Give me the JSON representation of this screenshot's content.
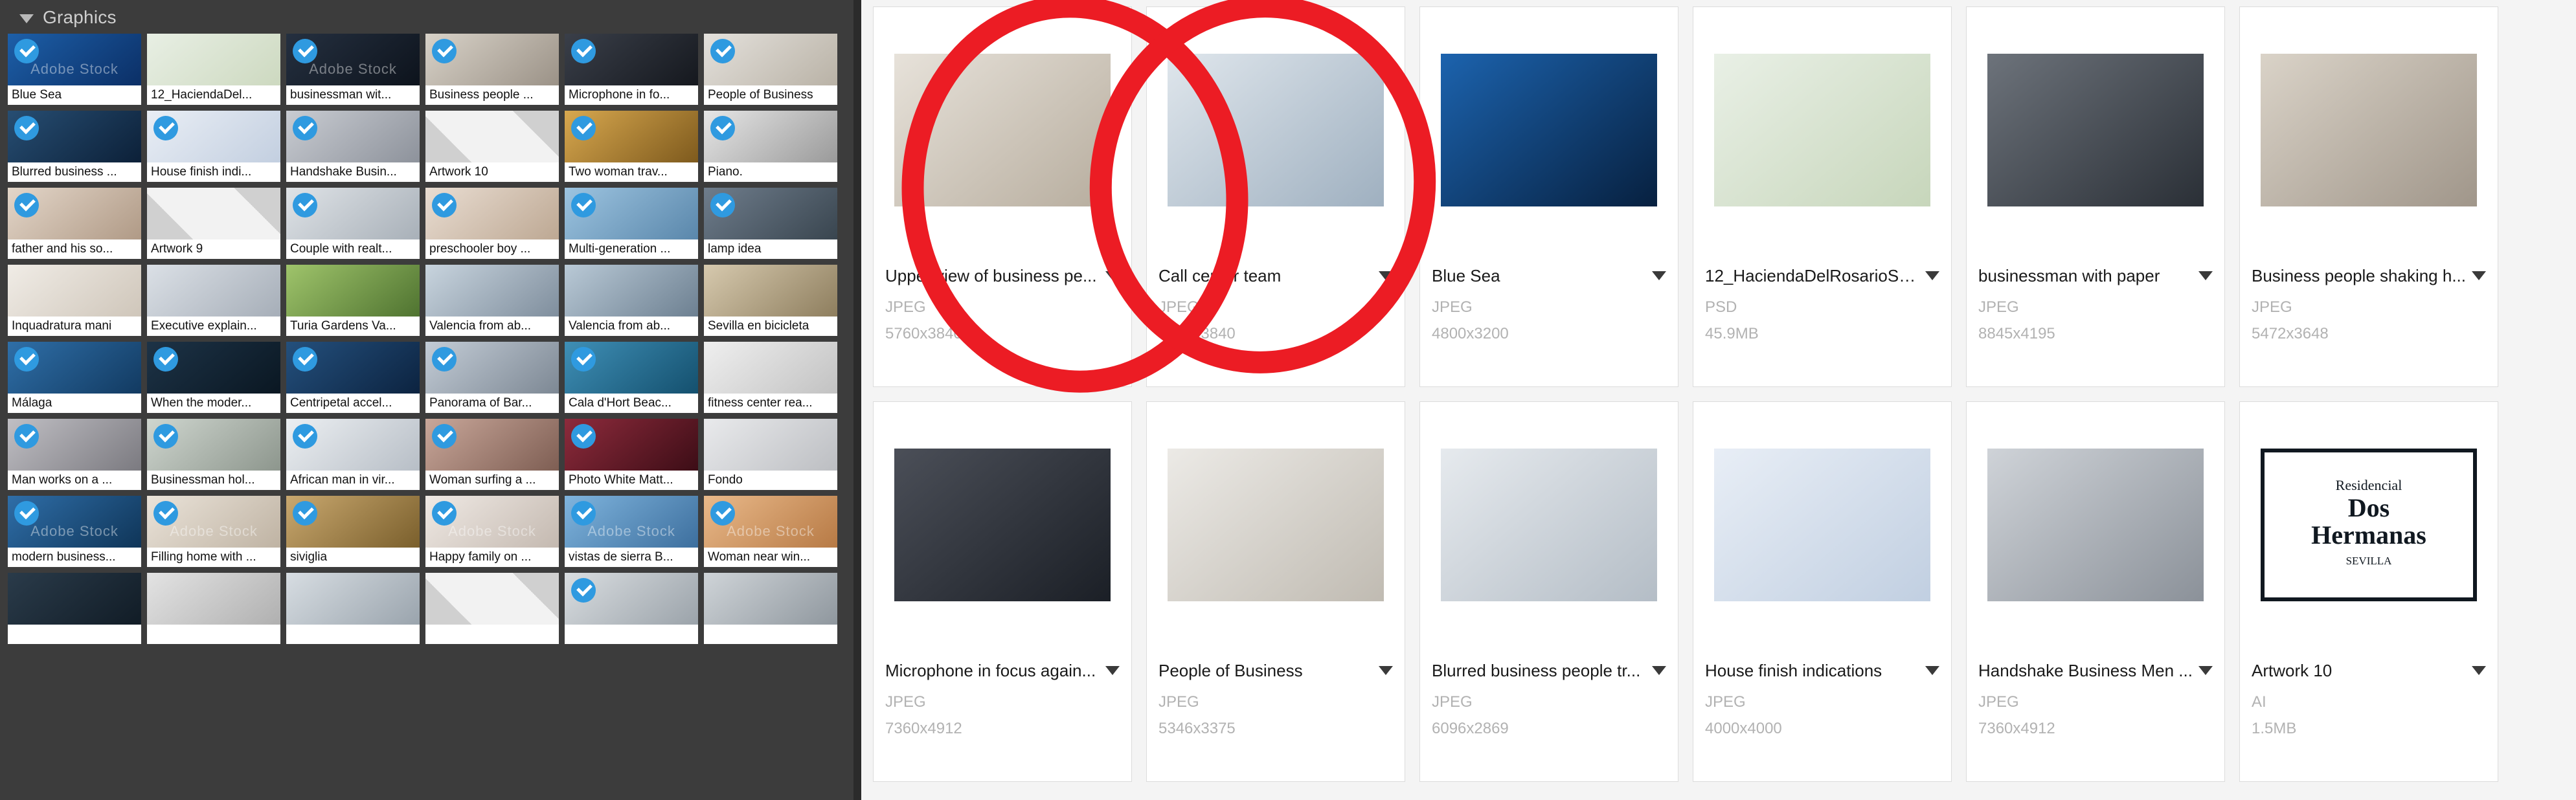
{
  "sidebar": {
    "header": {
      "title": "Graphics",
      "collapse_icon": "triangle-down-icon"
    },
    "watermark_text": "Adobe Stock",
    "items": [
      {
        "label": "Blue Sea",
        "selected": true,
        "c1": "#1d5fa8",
        "c2": "#0b2f66",
        "wm": true
      },
      {
        "label": "12_HaciendaDel...",
        "selected": false,
        "c1": "#e8efe4",
        "c2": "#cdd9c0",
        "wm": false
      },
      {
        "label": "businessman wit...",
        "selected": true,
        "c1": "#253040",
        "c2": "#0d131c",
        "wm": true
      },
      {
        "label": "Business people ...",
        "selected": true,
        "c1": "#d8d2c8",
        "c2": "#9b9287",
        "wm": false
      },
      {
        "label": "Microphone in fo...",
        "selected": true,
        "c1": "#3a3f49",
        "c2": "#15181e",
        "wm": false
      },
      {
        "label": "People of Business",
        "selected": true,
        "c1": "#e4e1dc",
        "c2": "#b9b2a6",
        "wm": false
      },
      {
        "label": "Blurred business ...",
        "selected": true,
        "c1": "#274e73",
        "c2": "#0c2038",
        "wm": false
      },
      {
        "label": "House finish indi...",
        "selected": true,
        "c1": "#e9eef5",
        "c2": "#c3cfe0",
        "wm": false
      },
      {
        "label": "Handshake Busin...",
        "selected": true,
        "c1": "#c9ccd2",
        "c2": "#8d929b",
        "wm": false
      },
      {
        "label": "Artwork 10",
        "selected": false,
        "c1": "#2b2b2b",
        "c2": "#1a1a1a",
        "wm": false,
        "checker": true
      },
      {
        "label": "Two woman trav...",
        "selected": true,
        "c1": "#d8a84f",
        "c2": "#7e5a1d",
        "wm": false
      },
      {
        "label": "Piano.",
        "selected": true,
        "c1": "#e6e6e6",
        "c2": "#9a9a9a",
        "wm": false
      },
      {
        "label": "father and his so...",
        "selected": true,
        "c1": "#e3d6c9",
        "c2": "#b09a86",
        "wm": false
      },
      {
        "label": "Artwork 9",
        "selected": false,
        "c1": "#2f3a46",
        "c2": "#16202b",
        "wm": false,
        "checker": true
      },
      {
        "label": "Couple with realt...",
        "selected": true,
        "c1": "#dfe3e7",
        "c2": "#a8b0b8",
        "wm": false
      },
      {
        "label": "preschooler boy ...",
        "selected": true,
        "c1": "#e9ddd2",
        "c2": "#bda893",
        "wm": false
      },
      {
        "label": "Multi-generation ...",
        "selected": true,
        "c1": "#9dc4e0",
        "c2": "#5a87ab",
        "wm": false
      },
      {
        "label": "lamp idea",
        "selected": true,
        "c1": "#6f7d8c",
        "c2": "#39454f",
        "wm": false
      },
      {
        "label": "Inquadratura mani",
        "selected": false,
        "c1": "#f0ece6",
        "c2": "#cfc6ba",
        "wm": false
      },
      {
        "label": "Executive explain...",
        "selected": false,
        "c1": "#dbe0e6",
        "c2": "#a6aeb8",
        "wm": false
      },
      {
        "label": "Turia Gardens Va...",
        "selected": false,
        "c1": "#9fc46b",
        "c2": "#4f7330",
        "wm": false
      },
      {
        "label": "Valencia from ab...",
        "selected": false,
        "c1": "#c8d4de",
        "c2": "#7f8e9d",
        "wm": false
      },
      {
        "label": "Valencia from ab...",
        "selected": false,
        "c1": "#b9c9d6",
        "c2": "#6d8091",
        "wm": false
      },
      {
        "label": "Sevilla en bicicleta",
        "selected": false,
        "c1": "#d6c9ae",
        "c2": "#8e7e5e",
        "wm": false
      },
      {
        "label": "Málaga",
        "selected": true,
        "c1": "#2f6fa8",
        "c2": "#123a61",
        "wm": false
      },
      {
        "label": "When the moder...",
        "selected": true,
        "c1": "#1d3347",
        "c2": "#0a1722",
        "wm": false
      },
      {
        "label": "Centripetal accel...",
        "selected": true,
        "c1": "#24507d",
        "c2": "#0c2340",
        "wm": false
      },
      {
        "label": "Panorama of Bar...",
        "selected": true,
        "c1": "#c3ccd6",
        "c2": "#7d8894",
        "wm": false
      },
      {
        "label": "Cala d'Hort Beac...",
        "selected": true,
        "c1": "#3f8fb6",
        "c2": "#14506e",
        "wm": false
      },
      {
        "label": "fitness center rea...",
        "selected": false,
        "c1": "#efefef",
        "c2": "#c2c2c2",
        "wm": false
      },
      {
        "label": "Man works on a ...",
        "selected": true,
        "c1": "#c0bfc4",
        "c2": "#7b7a80",
        "wm": false
      },
      {
        "label": "Businessman hol...",
        "selected": true,
        "c1": "#cfd6cf",
        "c2": "#8d968d",
        "wm": false
      },
      {
        "label": "African man in vir...",
        "selected": true,
        "c1": "#eceff2",
        "c2": "#b7bec6",
        "wm": false
      },
      {
        "label": "Woman surfing a ...",
        "selected": true,
        "c1": "#c9a79a",
        "c2": "#7e5e53",
        "wm": false
      },
      {
        "label": "Photo White Matt...",
        "selected": true,
        "c1": "#8e2b3c",
        "c2": "#3c0d16",
        "wm": false
      },
      {
        "label": "Fondo",
        "selected": false,
        "c1": "#e9eaec",
        "c2": "#bcbec2",
        "wm": false
      },
      {
        "label": "modern business...",
        "selected": true,
        "c1": "#2f6ea8",
        "c2": "#0f3558",
        "wm": true
      },
      {
        "label": "Filling home with ...",
        "selected": true,
        "c1": "#eae3d9",
        "c2": "#bfb3a3",
        "wm": true
      },
      {
        "label": "siviglia",
        "selected": true,
        "c1": "#c9a86f",
        "c2": "#7a5f2c",
        "wm": false
      },
      {
        "label": "Happy family on ...",
        "selected": true,
        "c1": "#efe9e4",
        "c2": "#c4b9b0",
        "wm": true
      },
      {
        "label": "vistas de sierra B...",
        "selected": true,
        "c1": "#7fb4dd",
        "c2": "#3d6f9e",
        "wm": true
      },
      {
        "label": "Woman near win...",
        "selected": true,
        "c1": "#e9b98a",
        "c2": "#b77a45",
        "wm": true
      },
      {
        "label": "",
        "selected": false,
        "c1": "#2a3b4a",
        "c2": "#111c26",
        "wm": false
      },
      {
        "label": "",
        "selected": false,
        "c1": "#e3e3e3",
        "c2": "#b0b0b0",
        "wm": false
      },
      {
        "label": "",
        "selected": false,
        "c1": "#d7dde2",
        "c2": "#9aa4ad",
        "wm": false
      },
      {
        "label": "",
        "selected": false,
        "c1": "#3a3a3a",
        "c2": "#1f1f1f",
        "wm": false,
        "checker": true
      },
      {
        "label": "",
        "selected": true,
        "c1": "#d9dde0",
        "c2": "#9ba3aa",
        "wm": false
      },
      {
        "label": "",
        "selected": false,
        "c1": "#cfd4d8",
        "c2": "#8f979e",
        "wm": false
      }
    ]
  },
  "main": {
    "cards": [
      {
        "title": "Upper view of business pe...",
        "format": "JPEG",
        "size": "5760x3840",
        "caret": "triangle-down-icon",
        "c1": "#e7e2da",
        "c2": "#b7ad9e",
        "annotated": true
      },
      {
        "title": "Call center team",
        "format": "JPEG",
        "size": "5760x3840",
        "caret": "triangle-down-icon",
        "c1": "#dfe6ec",
        "c2": "#9fb0c0",
        "annotated": true
      },
      {
        "title": "Blue Sea",
        "format": "JPEG",
        "size": "4800x3200",
        "caret": "triangle-down-icon",
        "c1": "#1c63ae",
        "c2": "#07203f",
        "annotated": false
      },
      {
        "title": "12_HaciendaDelRosarioSe...",
        "format": "PSD",
        "size": "45.9MB",
        "caret": "triangle-down-icon",
        "c1": "#e9f0e6",
        "c2": "#c7d6bb",
        "annotated": false
      },
      {
        "title": "businessman with paper",
        "format": "JPEG",
        "size": "8845x4195",
        "caret": "triangle-down-icon",
        "c1": "#6d737b",
        "c2": "#2a2f36",
        "annotated": false
      },
      {
        "title": "Business people shaking h...",
        "format": "JPEG",
        "size": "5472x3648",
        "caret": "triangle-down-icon",
        "c1": "#dad3c8",
        "c2": "#a0968a",
        "annotated": false
      },
      {
        "title": "Microphone in focus again...",
        "format": "JPEG",
        "size": "7360x4912",
        "caret": "triangle-down-icon",
        "c1": "#4b4f58",
        "c2": "#1b1f26",
        "annotated": false
      },
      {
        "title": "People of Business",
        "format": "JPEG",
        "size": "5346x3375",
        "caret": "triangle-down-icon",
        "c1": "#eceae6",
        "c2": "#c0bbb2",
        "annotated": false
      },
      {
        "title": "Blurred business people tr...",
        "format": "JPEG",
        "size": "6096x2869",
        "caret": "triangle-down-icon",
        "c1": "#e6eaee",
        "c2": "#b4bdc6",
        "annotated": false
      },
      {
        "title": "House finish indications",
        "format": "JPEG",
        "size": "4000x4000",
        "caret": "triangle-down-icon",
        "c1": "#e8eef6",
        "c2": "#c1cfe1",
        "annotated": false
      },
      {
        "title": "Handshake Business Men ...",
        "format": "JPEG",
        "size": "7360x4912",
        "caret": "triangle-down-icon",
        "c1": "#cfd3d8",
        "c2": "#8b9199",
        "annotated": false
      },
      {
        "title": "Artwork 10",
        "format": "AI",
        "size": "1.5MB",
        "caret": "triangle-down-icon",
        "c1": "#ffffff",
        "c2": "#ffffff",
        "annotated": false,
        "artwork_text": {
          "line1": "Residencial",
          "line2": "Dos",
          "line3": "Hermanas",
          "line4": "SEVILLA"
        }
      }
    ]
  },
  "annotation": {
    "color": "#ec1c24",
    "shapes": [
      "hand-drawn-circle-left",
      "hand-drawn-circle-right"
    ]
  }
}
